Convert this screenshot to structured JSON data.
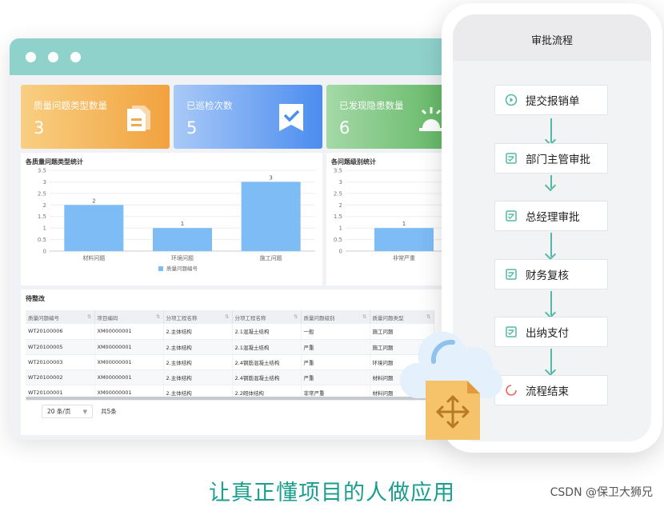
{
  "cards": [
    {
      "title": "质量问题类型数量",
      "value": "3",
      "icon": "document-icon"
    },
    {
      "title": "已巡检次数",
      "value": "5",
      "icon": "check-ribbon-icon"
    },
    {
      "title": "已发现隐患数量",
      "value": "6",
      "icon": "hazard-icon"
    }
  ],
  "chart1": {
    "title": "各质量问题类型统计",
    "chart_data": {
      "type": "bar",
      "categories": [
        "材料问题",
        "环境问题",
        "施工问题"
      ],
      "series": [
        {
          "name": "质量问题编号",
          "values": [
            2,
            1,
            3
          ]
        }
      ],
      "ylim": [
        0,
        3.5
      ],
      "yticks": [
        "0",
        "0.5",
        "1",
        "1.5",
        "2",
        "2.5",
        "3",
        "3.5"
      ],
      "grid": true,
      "legend": "bottom",
      "color": "#7ebcf6"
    }
  },
  "chart2": {
    "title": "各问题级别统计",
    "chart_data": {
      "type": "bar",
      "categories": [
        "非常严重"
      ],
      "series": [
        {
          "values": [
            1
          ]
        }
      ],
      "ylim": [
        0,
        3.5
      ],
      "yticks": [
        "0",
        "0.5",
        "1",
        "1.5",
        "2",
        "2.5",
        "3",
        "3.5"
      ],
      "grid": true,
      "color": "#7ebcf6"
    }
  },
  "table": {
    "title": "待整改",
    "columns": [
      "质量问题编号",
      "项目编码",
      "分项工程名称",
      "分项工程名称",
      "质量问题级别",
      "质量问题类型"
    ],
    "rows": [
      [
        "WT20100006",
        "XM00000001",
        "2.主体结构",
        "2.1混凝土结构",
        "一般",
        "施工问题"
      ],
      [
        "WT20100005",
        "XM00000001",
        "2.主体结构",
        "2.1混凝土结构",
        "严重",
        "施工问题"
      ],
      [
        "WT20100003",
        "XM00000001",
        "2.主体结构",
        "2.4钢筋混凝土结构",
        "严重",
        "环境问题"
      ],
      [
        "WT20100002",
        "XM00000001",
        "2.主体结构",
        "2.4钢筋混凝土结构",
        "严重",
        "材料问题"
      ],
      [
        "WT20100001",
        "XM00000001",
        "2.主体结构",
        "2.2砌体结构",
        "非常严重",
        "材料问题"
      ]
    ],
    "page_size": "20 条/页",
    "total": "共5条"
  },
  "phone": {
    "title": "审批流程",
    "steps": [
      {
        "label": "提交报销单",
        "icon": "play-circle-icon"
      },
      {
        "label": "部门主管审批",
        "icon": "form-check-icon"
      },
      {
        "label": "总经理审批",
        "icon": "form-check-icon"
      },
      {
        "label": "财务复核",
        "icon": "form-check-icon"
      },
      {
        "label": "出纳支付",
        "icon": "form-check-icon"
      },
      {
        "label": "流程结束",
        "icon": "end-circle-icon"
      }
    ],
    "accent": "#55b8a6"
  },
  "slogan": "让真正懂项目的人做应用",
  "watermark": "CSDN @保卫大狮兄"
}
